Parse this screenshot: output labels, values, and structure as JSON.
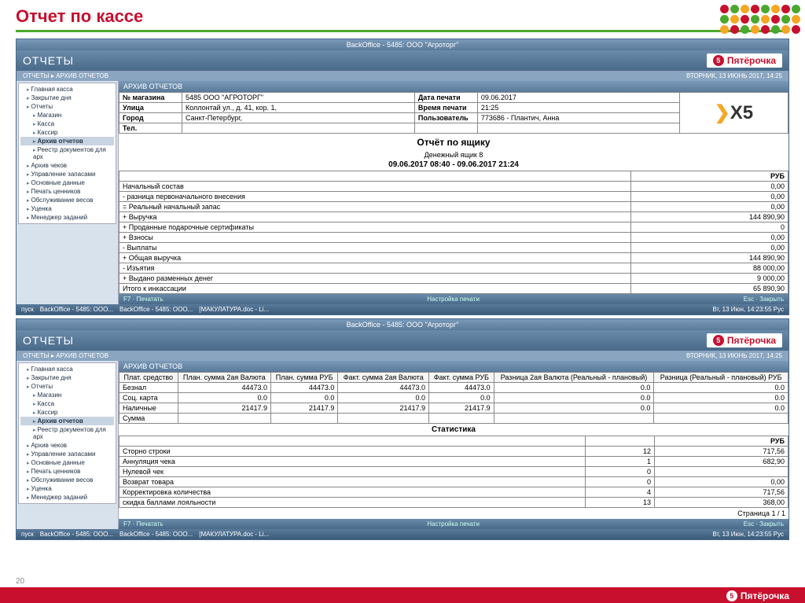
{
  "slide": {
    "title": "Отчет по кассе",
    "number": "20"
  },
  "brand": {
    "name": "Пятёрочка",
    "symbol": "5"
  },
  "app": {
    "titlebar": "BackOffice - 5485: ООО \"Агроторг\"",
    "title": "ОТЧЕТЫ",
    "breadcrumb": "ОТЧЕТЫ ▸ АРХИВ ОТЧЕТОВ",
    "status_right": "ВТОРНИК, 13 ИЮНЬ 2017, 14:25",
    "panel_header": "АРХИВ ОТЧЕТОВ"
  },
  "sidebar": {
    "items": [
      "Главная касса",
      "Закрытие дня",
      "Отчеты",
      "Магазин",
      "Касса",
      "Кассир",
      "Архив отчетов",
      "Реестр документов для арх",
      "Архив чеков",
      "Управление запасами",
      "Основные данные",
      "Печать ценников",
      "Обслуживание весов",
      "Уценка",
      "Менеджер заданий"
    ]
  },
  "info": {
    "store_label": "№ магазина",
    "store_value": "5485  ООО \"АГРОТОРГ\"",
    "street_label": "Улица",
    "street_value": "Коллонтай ул., д. 41, кор. 1,",
    "city_label": "Город",
    "city_value": "Санкт-Петербург,",
    "tel_label": "Тел.",
    "date_label": "Дата печати",
    "date_value": "09.06.2017",
    "time_label": "Время печати",
    "time_value": "21:25",
    "user_label": "Пользователь",
    "user_value": "773686 - Плантич, Анна",
    "x5": "X5"
  },
  "report1": {
    "title": "Отчёт по ящику",
    "subtitle": "Денежный ящик 8",
    "period": "09.06.2017 08:40 - 09.06.2017 21:24",
    "currency": "РУБ",
    "rows": [
      {
        "label": "Начальный состав",
        "value": "0,00"
      },
      {
        "label": "- разница первоначального внесения",
        "value": "0,00"
      },
      {
        "label": "= Реальный начальный запас",
        "value": "0,00"
      },
      {
        "label": "+ Выручка",
        "value": "144 890,90"
      },
      {
        "label": "+ Проданные подарочные сертификаты",
        "value": "0"
      },
      {
        "label": "+ Взносы",
        "value": "0,00"
      },
      {
        "label": "- Выплаты",
        "value": "0,00"
      },
      {
        "label": "+ Общая выручка",
        "value": "144 890,90"
      },
      {
        "label": "- Изъятия",
        "value": "88 000,00"
      },
      {
        "label": "+ Выдано разменных денег",
        "value": "9 000,00"
      },
      {
        "label": "Итого к инкассации",
        "value": "65 890,90"
      }
    ]
  },
  "report2": {
    "headers": [
      "Плат. средство",
      "План. сумма 2ая Валюта",
      "План. сумма РУБ",
      "Факт. сумма 2ая Валюта",
      "Факт. сумма РУБ",
      "Разница 2ая Валюта (Реальный - плановый)",
      "Разница (Реальный - плановый) РУБ"
    ],
    "rows": [
      {
        "c": [
          "Безнал",
          "44473.0",
          "44473.0",
          "44473.0",
          "44473.0",
          "0.0",
          "0.0"
        ]
      },
      {
        "c": [
          "Соц. карта",
          "0.0",
          "0.0",
          "0.0",
          "0.0",
          "0.0",
          "0.0"
        ]
      },
      {
        "c": [
          "Наличные",
          "21417.9",
          "21417.9",
          "21417.9",
          "21417.9",
          "0.0",
          "0.0"
        ]
      },
      {
        "c": [
          "Сумма",
          "",
          "",
          "",
          "",
          "",
          ""
        ]
      }
    ],
    "stat_title": "Статистика",
    "stat_currency": "РУБ",
    "stats": [
      {
        "label": "Сторно строки",
        "count": "12",
        "value": "717,56"
      },
      {
        "label": "Аннуляция чека",
        "count": "1",
        "value": "682,90"
      },
      {
        "label": "Нулевой чек",
        "count": "0",
        "value": ""
      },
      {
        "label": "Возврат товара",
        "count": "0",
        "value": "0,00"
      },
      {
        "label": "Корректировка количества",
        "count": "4",
        "value": "717,56"
      },
      {
        "label": "скидка баллами лояльности",
        "count": "13",
        "value": "368,00"
      }
    ],
    "page": "Страница 1 / 1"
  },
  "footer_actions": {
    "print": "F7 · Печатать",
    "settings": "Настройка печати",
    "close": "Esc · Закрыть"
  },
  "taskbar": {
    "items": [
      "пуск",
      "BackOffice - 5485: ООО...",
      "BackOffice - 5485: ООО...",
      "[МАКУЛАТУРА.doc - Li..."
    ],
    "time": "Вт, 13 Июн, 14:23:55   Рус"
  }
}
